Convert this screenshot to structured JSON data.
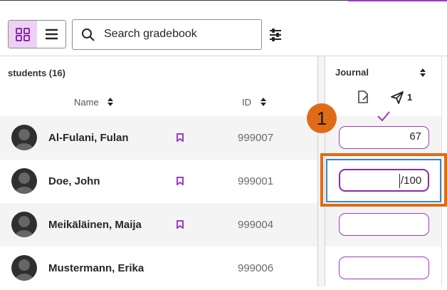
{
  "toolbar": {
    "search_placeholder": "Search gradebook",
    "grid_view_icon": "grid-icon",
    "list_view_icon": "list-icon",
    "filter_icon": "filter-sliders-icon"
  },
  "students": {
    "heading": "students (16)",
    "name_header": "Name",
    "id_header": "ID",
    "rows": [
      {
        "name": "Al-Fulani, Fulan",
        "id": "999007",
        "grade": "67"
      },
      {
        "name": "Doe, John",
        "id": "999001",
        "grade": ""
      },
      {
        "name": "Meikäläinen, Maija",
        "id": "999004",
        "grade": ""
      },
      {
        "name": "Mustermann, Erika",
        "id": "999006",
        "grade": ""
      }
    ]
  },
  "journal": {
    "title": "Journal",
    "posted_count": "1",
    "active_cell_suffix": "/100"
  },
  "callout": {
    "number": "1"
  },
  "colors": {
    "accent": "#9e3bbf",
    "selected_bg": "#ecd1f4",
    "callout": "#e06b16",
    "focus": "#3a87c6"
  }
}
